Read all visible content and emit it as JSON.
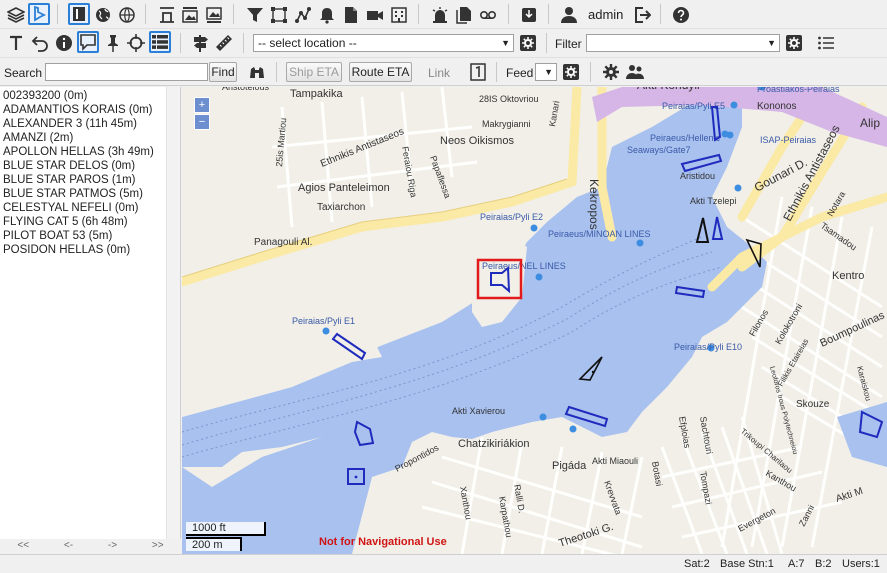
{
  "toolbar_top": {
    "user": "admin",
    "icons": [
      "layers-icon",
      "bing-icon",
      "panel-toggle-icon",
      "globe-icon",
      "align-top-icon",
      "image-top-icon",
      "image-bottom-icon",
      "filter-icon",
      "polygon-icon",
      "route-icon",
      "alarm-bell-icon",
      "document-icon",
      "camera-icon",
      "building-icon",
      "alarm-light-icon",
      "documents-icon",
      "voicemail-icon",
      "inbox-icon",
      "user-icon",
      "logout-icon",
      "help-icon"
    ]
  },
  "toolbar_mid": {
    "location_select": "-- select location --",
    "filter_label": "Filter",
    "filter_value": ""
  },
  "toolbar_search": {
    "search_label": "Search",
    "search_value": "",
    "find_button": "Find",
    "ship_eta_button": "Ship ETA",
    "route_eta_button": "Route ETA",
    "link_label": "Link",
    "feed_label": "Feed",
    "feed_value": ""
  },
  "vessels": [
    "002393200 (0m)",
    "ADAMANTIOS KORAIS (0m)",
    "ALEXANDER 3 (11h 45m)",
    "AMANZI (2m)",
    "APOLLON HELLAS (3h 49m)",
    "BLUE STAR DELOS (0m)",
    "BLUE STAR PAROS (1m)",
    "BLUE STAR PATMOS (5m)",
    "CELESTYAL NEFELI (0m)",
    "FLYING CAT 5 (6h 48m)",
    "PILOT BOAT 53 (5m)",
    "POSIDON HELLAS (0m)"
  ],
  "pager": [
    "<<",
    "<-",
    "->",
    ">>"
  ],
  "map": {
    "zoom_in": "+",
    "zoom_out": "−",
    "scale_imperial": "1000 ft",
    "scale_metric": "200 m",
    "disclaimer": "Not for Navigational Use",
    "labels": {
      "akti_kondyli": "Akti Kondyli",
      "kekropos": "Kekropos",
      "tampakika": "Tampakika",
      "aristotelous": "Aristotelous",
      "okt": "28IS Oktovriou",
      "makrygianni": "Makrygianni",
      "kanari": "Kanari",
      "neos_oikismos": "Neos Oikismos",
      "ethnikis1": "Ethnikis Antistaseos",
      "martiou": "25is Martiou",
      "feraiou": "Feraiou Riga",
      "papaflessa": "Papaflessa",
      "agios": "Agios Panteleimon",
      "taxiarchon": "Taxiarchon",
      "panagouli": "Panagouli Al.",
      "pyli_e2": "Peiraias/Pyli E2",
      "minoan": "Peiraeus/MINOAN LINES",
      "nel": "Peiraeus/NEL LINES",
      "pyli_e1": "Peiraias/Pyli E1",
      "pyli_e5": "Peiraias/Pyli E5",
      "hellenic1": "Peiraeus/Hellenic",
      "hellenic2": "Seaways/Gate7",
      "akti_tzelepi": "Akti Tzelepi",
      "aristidou": "Aristidou",
      "gounari": "Gounari D.",
      "ethnikis2": "Ethnikis Antistaseos",
      "kentro": "Kentro",
      "pyli_e10": "Peiraias/Pyli E10",
      "proastiakos": "Proastiakos-Peiraias",
      "kononos": "Kononos",
      "isap": "ISAP-Peiraias",
      "alip": "Alip",
      "notara": "Notara",
      "tsamadou": "Tsamadou",
      "filonos": "Filonos",
      "kolokotroni": "Kolokotroni",
      "boumpoulinas": "Boumpoulinas",
      "skouze": "Skouze",
      "akti_xavierou": "Akti Xavierou",
      "chatzikiriakion": "Chatzikiriákion",
      "propontidos": "Propontidos",
      "xanthou": "Xanthou",
      "ralli": "Ralli D.",
      "pigada": "Pigáda",
      "akti_miaouli": "Akti Miaouli",
      "kreyvata": "Krevvata",
      "botasi": "Botasi",
      "efplois": "Efploias",
      "sachtouri": "Sachtouri",
      "tompazi": "Tompazi",
      "theotoki": "Theotoki G.",
      "kanthou": "Kanthou",
      "evergeton": "Evergeton",
      "zanni": "Zanni",
      "akti_moutsopoulou": "Akti M",
      "karpathou": "Karpathou",
      "trikoupi": "Trikoupi Charilaou",
      "filikis": "Filikis Etaireias",
      "leoforos": "Leoforos Irous Polytechneiou",
      "karaiskou": "Karaiskou"
    }
  },
  "status": {
    "sat": "Sat:2",
    "base_stn": "Base Stn:1",
    "a": "A:7",
    "b": "B:2",
    "users": "Users:1"
  },
  "colors": {
    "water": "#a8c1ef",
    "land": "#f1efe8",
    "major_road": "#fbe9a6",
    "highlight": "#e31a1c",
    "vessel_class_a": "#1f2bbd",
    "vessel_class_b": "#111111"
  }
}
